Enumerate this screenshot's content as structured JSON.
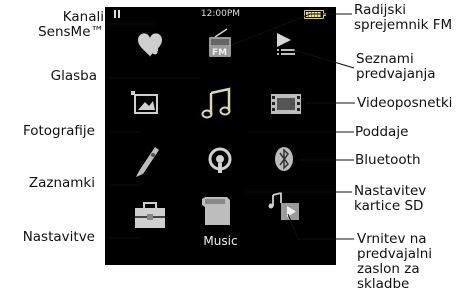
{
  "status_bar": {
    "time": "12:00PM"
  },
  "focused_item_label": "Music",
  "labels": {
    "kanali_sensme": "Kanali\nSensMe™",
    "glasba": "Glasba",
    "fotografije": "Fotografije",
    "zaznamki": "Zaznamki",
    "nastavitve": "Nastavitve",
    "radijski": "Radijski\nsprejemnik FM",
    "seznami": "Seznami\npredvajanja",
    "videoposnetki": "Videoposnetki",
    "poddaje": "Poddaje",
    "bluetooth": "Bluetooth",
    "nastavitev_kartice": "Nastavitev\nkartice SD",
    "vrnitev": "Vrnitev na\npredvajalni\nzaslon za\nskladbe"
  },
  "icons": [
    "sensme-heart-icon",
    "radio-fm-icon",
    "playlist-icon",
    "photo-icon",
    "music-note-icon",
    "video-film-icon",
    "bookmark-icon",
    "podcast-icon",
    "bluetooth-icon",
    "toolbox-icon",
    "sd-card-icon",
    "now-playing-icon"
  ]
}
